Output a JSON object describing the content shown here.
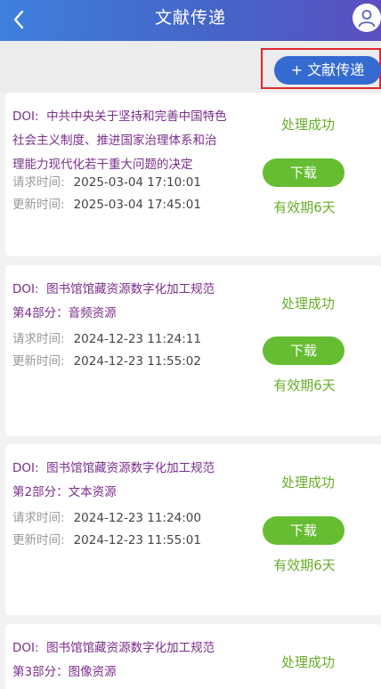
{
  "header": {
    "title": "文献传递",
    "back_icon": "chevron-left-icon",
    "avatar_icon": "user-icon"
  },
  "toolbar": {
    "add_label": "+ 文献传递",
    "highlight_color": "#e0282c"
  },
  "colors": {
    "doi": "#7a2d8b",
    "status": "#69ad2a",
    "download_button": "#66bd31",
    "accent": "#356ad1"
  },
  "records": [
    {
      "doi_label": "DOI:",
      "doi_lines": [
        "中共中央关于坚持和完善中国特色",
        "社会主义制度、推进国家治理体系和治",
        "理能力现代化若干重大问题的决定"
      ],
      "request_label": "请求时间:",
      "request_time": "2025-03-04 17:10:01",
      "update_label": "更新时间:",
      "update_time": "2025-03-04 17:45:01",
      "status": "处理成功",
      "download_label": "下载",
      "validity": "有效期6天"
    },
    {
      "doi_label": "DOI:",
      "doi_lines": [
        "图书馆馆藏资源数字化加工规范",
        "第4部分：音频资源"
      ],
      "request_label": "请求时间:",
      "request_time": "2024-12-23 11:24:11",
      "update_label": "更新时间:",
      "update_time": "2024-12-23 11:55:02",
      "status": "处理成功",
      "download_label": "下载",
      "validity": "有效期6天"
    },
    {
      "doi_label": "DOI:",
      "doi_lines": [
        "图书馆馆藏资源数字化加工规范",
        "第2部分：文本资源"
      ],
      "request_label": "请求时间:",
      "request_time": "2024-12-23 11:24:00",
      "update_label": "更新时间:",
      "update_time": "2024-12-23 11:55:01",
      "status": "处理成功",
      "download_label": "下载",
      "validity": "有效期6天"
    },
    {
      "doi_label": "DOI:",
      "doi_lines": [
        "图书馆馆藏资源数字化加工规范",
        "第3部分：图像资源"
      ],
      "status": "处理成功"
    }
  ]
}
